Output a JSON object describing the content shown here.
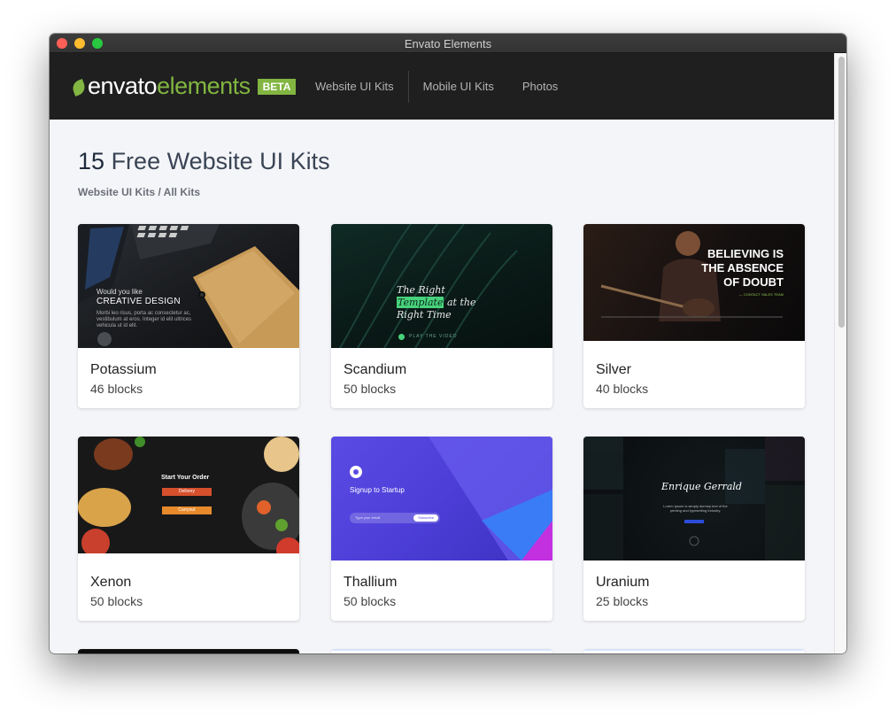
{
  "window": {
    "title": "Envato Elements"
  },
  "nav": {
    "logo_primary": "envato",
    "logo_secondary": "elements",
    "badge": "BETA",
    "links": [
      "Website UI Kits",
      "Mobile UI Kits",
      "Photos"
    ]
  },
  "page": {
    "count": "15",
    "title_rest": "Free Website UI Kits",
    "breadcrumb": "Website UI Kits / All Kits"
  },
  "colors": {
    "brand_green": "#82b541",
    "nav_bg": "#1f1f1f",
    "page_bg": "#f4f5f8"
  },
  "kits": [
    {
      "name": "Potassium",
      "blocks": "46 blocks",
      "thumb": {
        "line1": "Would you like",
        "line2": "CREATIVE DESIGN",
        "body": "Morbi leo risus, porta ac consectetur ac, vestibulum at eros. Integer id elit ultrices vehicula ut id elit."
      }
    },
    {
      "name": "Scandium",
      "blocks": "50 blocks",
      "thumb": {
        "line1": "The Right",
        "highlight": "Template",
        "line2_rest": "at the",
        "line3": "Right Time",
        "cta": "PLAY THE VIDEO"
      }
    },
    {
      "name": "Silver",
      "blocks": "40 blocks",
      "thumb": {
        "line1": "BELIEVING IS",
        "line2": "THE ABSENCE",
        "line3": "OF DOUBT",
        "cta": "— CONTACT SALES TEAM"
      }
    },
    {
      "name": "Xenon",
      "blocks": "50 blocks",
      "thumb": {
        "heading": "Start Your Order",
        "btn1": "Delivery",
        "btn2": "Carryout"
      }
    },
    {
      "name": "Thallium",
      "blocks": "50 blocks",
      "thumb": {
        "heading": "Signup to Startup",
        "input": "Type your email",
        "btn": "Subscribe"
      }
    },
    {
      "name": "Uranium",
      "blocks": "25 blocks",
      "thumb": {
        "script": "Enrique Gerrald",
        "body": "Lorem ipsum is simply dummy text of the printing and typesetting industry."
      }
    }
  ]
}
